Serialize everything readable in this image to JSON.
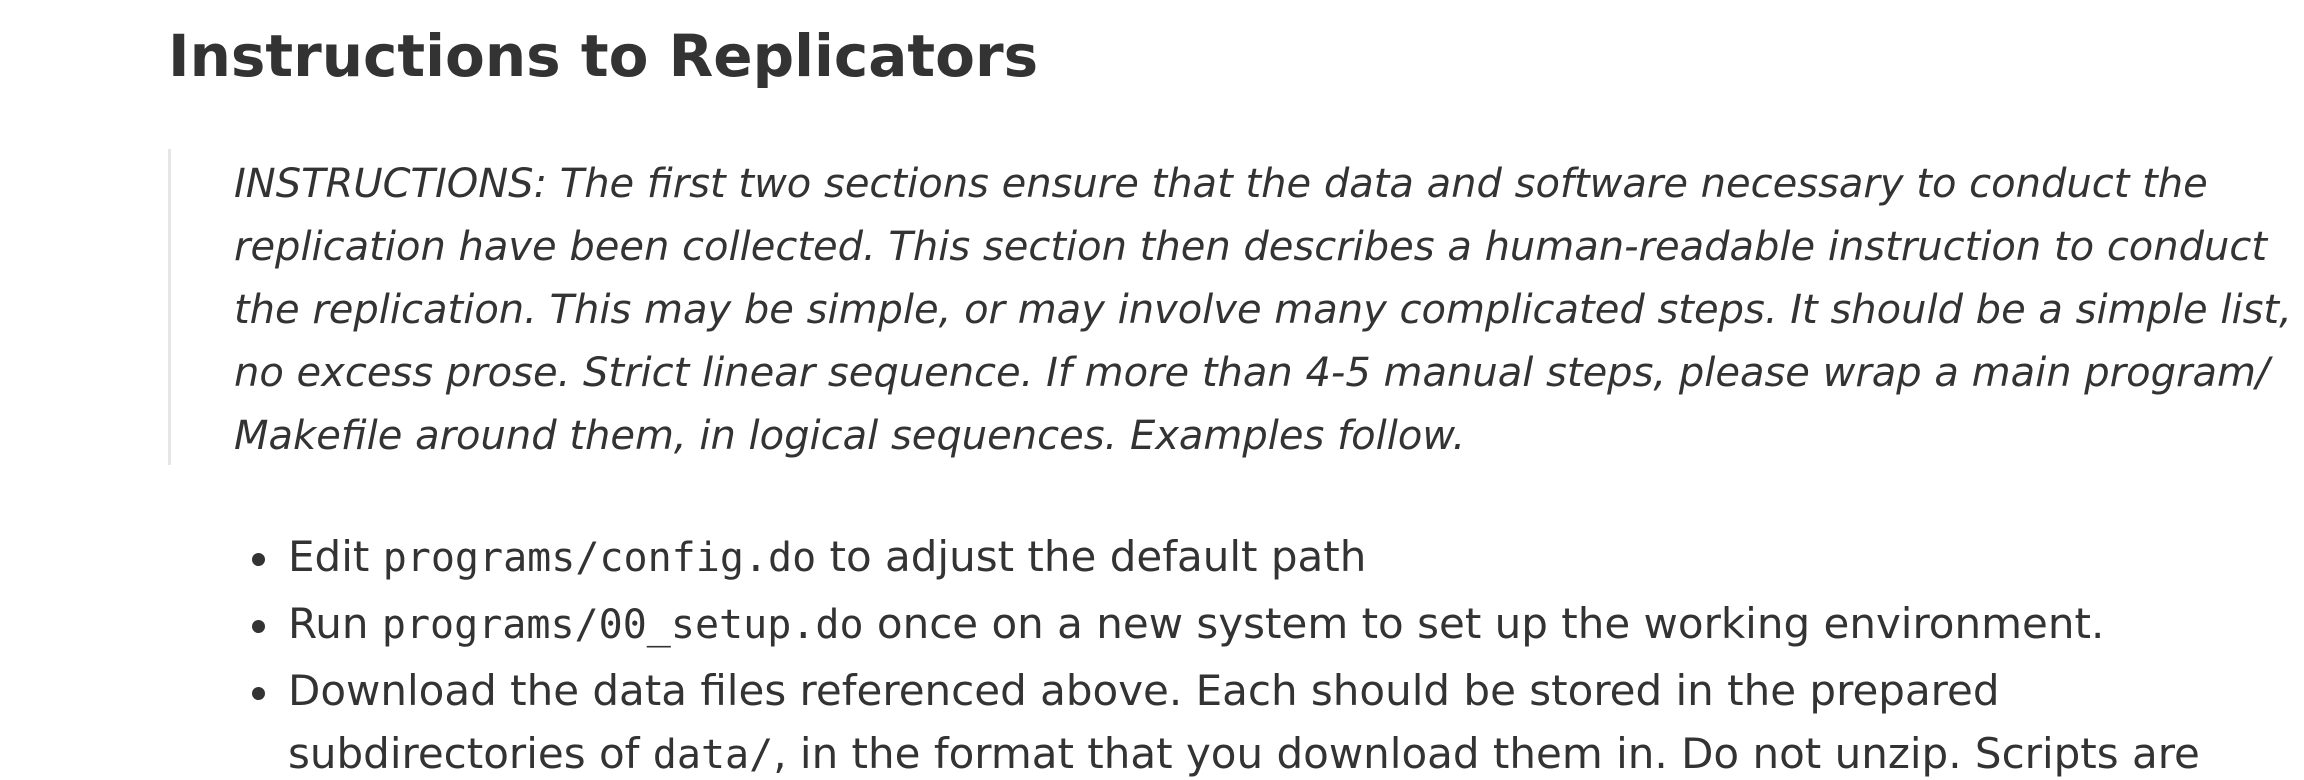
{
  "page": {
    "title": "Instructions to Replicators"
  },
  "instructions": {
    "lines": [
      "INSTRUCTIONS: The first two sections ensure that the data and software necessary to conduct the",
      "replication have been collected. This section then describes a human-readable instruction to conduct",
      "the replication. This may be simple, or may involve many complicated steps. It should be a simple list,",
      "no excess prose. Strict linear sequence. If more than 4-5 manual steps, please wrap a main program/",
      "Makefile around them, in logical sequences. Examples follow."
    ]
  },
  "steps": [
    {
      "prefix": "Edit ",
      "code": "programs/config.do",
      "suffix": " to adjust the default path"
    },
    {
      "prefix": "Run ",
      "code": "programs/00_setup.do",
      "suffix": " once on a new system to set up the working environment."
    },
    {
      "line1": "Download the data files referenced above. Each should be stored in the prepared",
      "line2_prefix": "subdirectories of ",
      "line2_code": "data/",
      "line2_suffix": ", in the format that you download them in. Do not unzip. Scripts are"
    }
  ]
}
